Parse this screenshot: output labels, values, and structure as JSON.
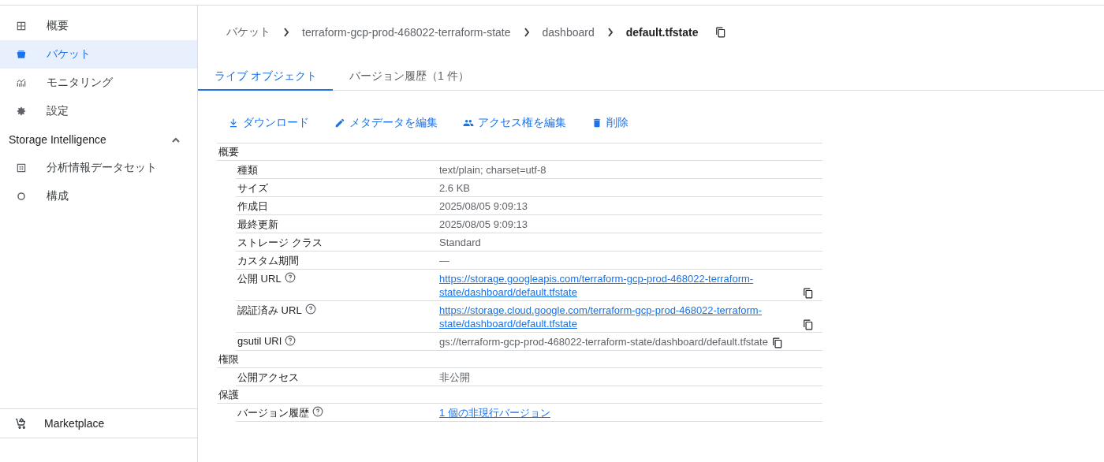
{
  "sidebar": {
    "items": [
      {
        "label": "概要",
        "selected": false
      },
      {
        "label": "バケット",
        "selected": true
      },
      {
        "label": "モニタリング",
        "selected": false
      },
      {
        "label": "設定",
        "selected": false
      }
    ],
    "section": {
      "title": "Storage Intelligence",
      "expanded": true,
      "items": [
        {
          "label": "分析情報データセット",
          "selected": false
        },
        {
          "label": "構成",
          "selected": false
        }
      ]
    },
    "footer": {
      "label": "Marketplace"
    }
  },
  "breadcrumb": [
    "バケット",
    "terraform-gcp-prod-468022-terraform-state",
    "dashboard",
    "default.tfstate"
  ],
  "tabs": [
    {
      "label": "ライブ オブジェクト",
      "selected": true
    },
    {
      "label": "バージョン履歴（1 件）",
      "selected": false
    }
  ],
  "actions": [
    "ダウンロード",
    "メタデータを編集",
    "アクセス権を編集",
    "削除"
  ],
  "sections": [
    {
      "title": "概要",
      "rows": [
        {
          "label": "種類",
          "help": false,
          "kind": "text",
          "value": "text/plain; charset=utf-8",
          "copy": false
        },
        {
          "label": "サイズ",
          "help": false,
          "kind": "text",
          "value": "2.6 KB",
          "copy": false
        },
        {
          "label": "作成日",
          "help": false,
          "kind": "text",
          "value": "2025/08/05 9:09:13",
          "copy": false
        },
        {
          "label": "最終更新",
          "help": false,
          "kind": "text",
          "value": "2025/08/05 9:09:13",
          "copy": false
        },
        {
          "label": "ストレージ クラス",
          "help": false,
          "kind": "text",
          "value": "Standard",
          "copy": false
        },
        {
          "label": "カスタム期間",
          "help": false,
          "kind": "text",
          "value": "—",
          "copy": false
        },
        {
          "label": "公開 URL",
          "help": true,
          "kind": "link",
          "value": "https://storage.googleapis.com/terraform-gcp-prod-468022-terraform-state/dashboard/default.tfstate",
          "copy": true
        },
        {
          "label": "認証済み URL",
          "help": true,
          "kind": "link",
          "value": "https://storage.cloud.google.com/terraform-gcp-prod-468022-terraform-state/dashboard/default.tfstate",
          "copy": true
        },
        {
          "label": "gsutil URI",
          "help": true,
          "kind": "text",
          "value": "gs://terraform-gcp-prod-468022-terraform-state/dashboard/default.tfstate",
          "copy": true
        }
      ]
    },
    {
      "title": "権限",
      "rows": [
        {
          "label": "公開アクセス",
          "help": false,
          "kind": "text",
          "value": "非公開",
          "copy": false
        }
      ]
    },
    {
      "title": "保護",
      "rows": [
        {
          "label": "バージョン履歴",
          "help": true,
          "kind": "link",
          "value": "1 個の非現行バージョン",
          "copy": false
        }
      ]
    }
  ]
}
